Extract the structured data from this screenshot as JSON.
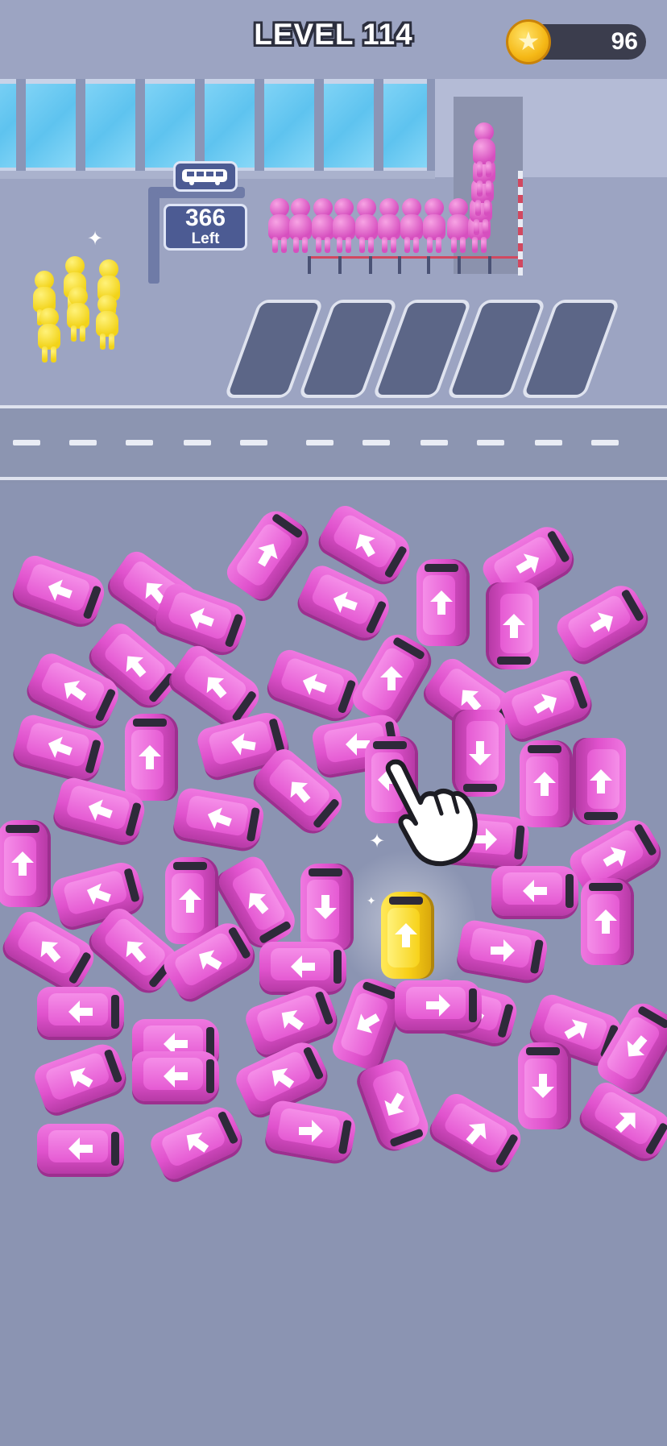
{
  "header": {
    "level_title": "LEVEL 114",
    "coins": "96",
    "coin_icon": "star-coin-icon"
  },
  "bus_stop": {
    "icon": "bus-icon",
    "remaining_count": "366",
    "remaining_label": "Left"
  },
  "queue": {
    "waiting_color": "pink",
    "boarding_color": "yellow"
  },
  "vans": {
    "selected_color": "yellow",
    "default_color": "pink",
    "arrow_directions": [
      "up",
      "left",
      "right",
      "down",
      "up-left",
      "up-right",
      "down-right"
    ]
  },
  "colors": {
    "van_pink": "#e052cd",
    "van_yellow": "#f8cf17",
    "ground": "#8b94b2",
    "glass": "#5ec3ef"
  }
}
